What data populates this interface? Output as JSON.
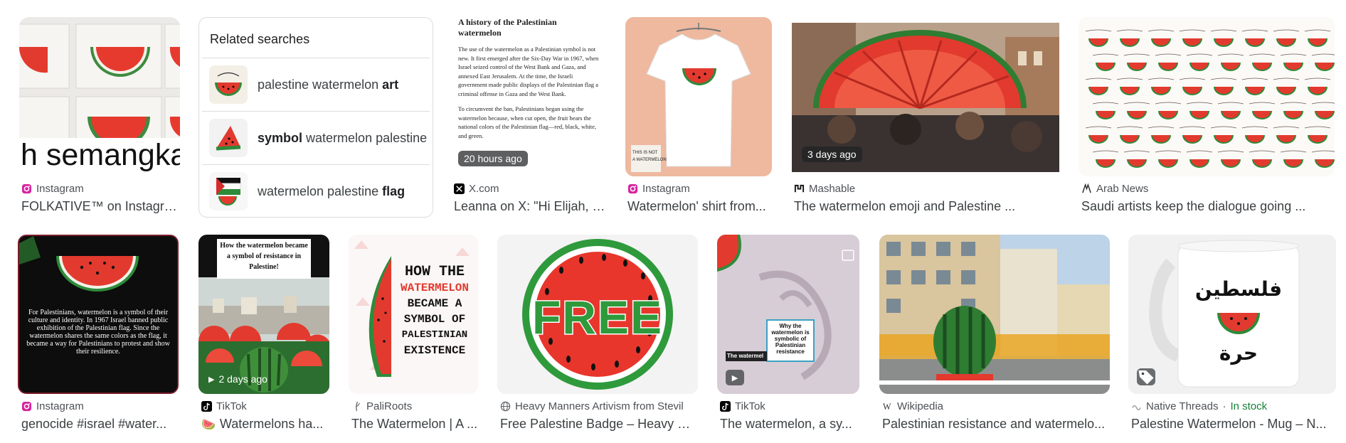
{
  "related": {
    "title": "Related searches",
    "items": [
      {
        "pre": "palestine watermelon ",
        "bold": "art",
        "post": ""
      },
      {
        "pre": "",
        "bold": "symbol",
        "post": " watermelon palestine"
      },
      {
        "pre": "watermelon palestine ",
        "bold": "flag",
        "post": ""
      }
    ]
  },
  "row1": [
    {
      "source": "Instagram",
      "title": "FOLKATIVE™ on Instagra...",
      "overlay_text": "h semangka",
      "favicon": "instagram-icon"
    },
    {
      "source": "X.com",
      "title": "Leanna on X: \"Hi Elijah, I'...",
      "badge": "20 hours ago",
      "favicon": "x-icon",
      "article": {
        "heading": "A history of the Palestinian watermelon",
        "p1": "The use of the watermelon as a Palestinian symbol is not new. It first emerged after the Six-Day War in 1967, when Israel seized control of the West Bank and Gaza, and annexed East Jerusalem. At the time, the Israeli government made public displays of the Palestinian flag a criminal offense in Gaza and the West Bank.",
        "p2": "To circumvent the ban, Palestinians began using the watermelon because, when cut open, the fruit bears the national colors of the Palestinian flag—red, black, white, and green."
      }
    },
    {
      "source": "Instagram",
      "title": "Watermelon' shirt from...",
      "favicon": "instagram-icon"
    },
    {
      "source": "Mashable",
      "title": "The watermelon emoji and Palestine ...",
      "badge": "3 days ago",
      "favicon": "mashable-icon"
    },
    {
      "source": "Arab News",
      "title": "Saudi artists keep the dialogue going ...",
      "favicon": "arab-news-icon"
    }
  ],
  "row2": [
    {
      "source": "Instagram",
      "title": "genocide #israel #water...",
      "favicon": "instagram-icon",
      "caption": "For Palestinians, watermelon is a symbol of their culture and identity. In 1967 Israel banned public exhibition of the Palestinian flag. Since the watermelon shares the same colors as the flag, it became a way for Palestinians to protest and show their resilience."
    },
    {
      "source": "TikTok",
      "title": "Watermelons ha...",
      "badge": "2 days ago",
      "favicon": "tiktok-icon",
      "caption": "How the watermelon became a symbol of resistance in Palestine!"
    },
    {
      "source": "PaliRoots",
      "title": "The Watermelon | A ...",
      "favicon": "paliroots-icon",
      "poster": [
        "HOW THE",
        "WATERMELON",
        "BECAME A",
        "SYMBOL OF",
        "PALESTINIAN",
        "EXISTENCE"
      ]
    },
    {
      "source": "Heavy Manners Artivism from Stevil",
      "title": "Free Palestine Badge – Heavy M...",
      "favicon": "globe-icon",
      "badge_word": "FREE"
    },
    {
      "source": "TikTok",
      "title": "The watermelon, a sy...",
      "favicon": "tiktok-icon",
      "caption": "Why the watermelon is symbolic of Palestinian resistance",
      "strip": "The watermel"
    },
    {
      "source": "Wikipedia",
      "title": "Palestinian resistance and watermelo...",
      "favicon": "wikipedia-icon"
    },
    {
      "source": "Native Threads",
      "stock": "In stock",
      "title": "Palestine Watermelon - Mug – N...",
      "favicon": "native-threads-icon",
      "mug_text": [
        "فلسطين",
        "حرة"
      ]
    }
  ],
  "colors": {
    "accent_green": "#188038",
    "watermelon_red": "#e8362c",
    "rind_green": "#2e8b3a"
  }
}
